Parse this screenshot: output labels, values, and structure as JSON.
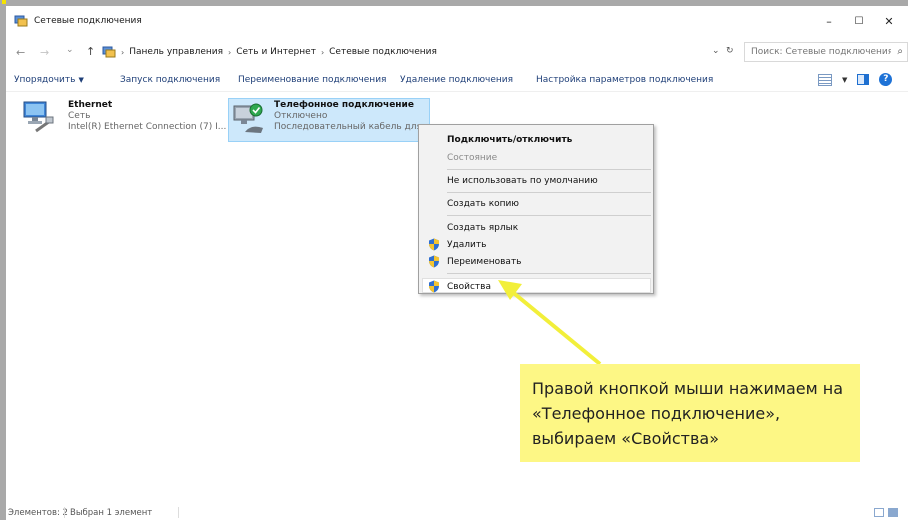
{
  "window": {
    "title": "Сетевые подключения",
    "controls": {
      "minimize": "–",
      "maximize": "☐",
      "close": "✕"
    }
  },
  "address": {
    "back": "←",
    "forward": "→",
    "history": "⌄",
    "up": "↑",
    "sep": "›",
    "crumbs": [
      "Панель управления",
      "Сеть и Интернет",
      "Сетевые подключения"
    ],
    "dropdown": "⌄",
    "refresh": "↻",
    "search_placeholder": "Поиск: Сетевые подключения",
    "search_icon": "⌕"
  },
  "commands": {
    "organize": "Упорядочить",
    "organize_chevron": "▼",
    "start": "Запуск подключения",
    "rename": "Переименование подключения",
    "delete": "Удаление подключения",
    "settings": "Настройка параметров подключения",
    "view_chevron": "▼",
    "help": "?"
  },
  "items": [
    {
      "name": "Ethernet",
      "status": "Сеть",
      "device": "Intel(R) Ethernet Connection (7) I..."
    },
    {
      "name": "Телефонное подключение",
      "status": "Отключено",
      "device": "Последовательный кабель для ..."
    }
  ],
  "context_menu": {
    "connect": "Подключить/отключить",
    "state": "Состояние",
    "default": "Не использовать по умолчанию",
    "copy": "Создать копию",
    "shortcut": "Создать ярлык",
    "delete": "Удалить",
    "rename": "Переименовать",
    "properties": "Свойства"
  },
  "callout": {
    "text": "Правой кнопкой мыши нажимаем на «Телефонное подключение», выбираем «Свойства»"
  },
  "status": {
    "count": "Элементов: 2",
    "selected": "Выбран 1 элемент"
  },
  "colors": {
    "accent": "#1e72d6",
    "link": "#1f3f78",
    "selection": "#cde8fb",
    "callout": "#fdf785",
    "arrow": "#f2ef3a"
  }
}
